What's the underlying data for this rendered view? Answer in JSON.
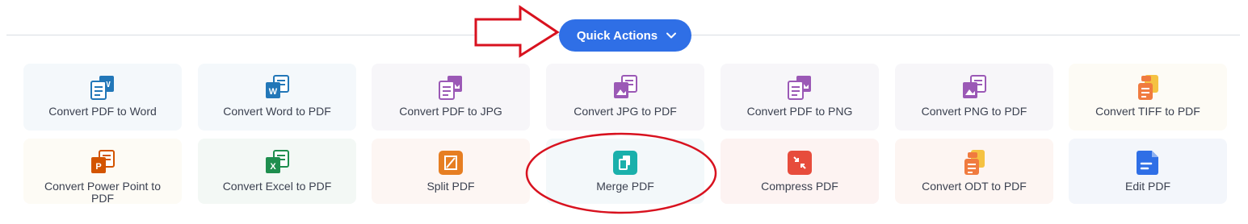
{
  "quick_actions": {
    "label": "Quick Actions"
  },
  "tools_row1": [
    {
      "label": "Convert PDF to Word",
      "icon": "pdf-to-word-icon",
      "bg": "#f4f8fb"
    },
    {
      "label": "Convert Word to PDF",
      "icon": "word-to-pdf-icon",
      "bg": "#f4f8fb"
    },
    {
      "label": "Convert PDF to JPG",
      "icon": "pdf-to-jpg-icon",
      "bg": "#f7f6f9"
    },
    {
      "label": "Convert JPG to PDF",
      "icon": "jpg-to-pdf-icon",
      "bg": "#f7f6f9"
    },
    {
      "label": "Convert PDF to PNG",
      "icon": "pdf-to-png-icon",
      "bg": "#f7f6f9"
    },
    {
      "label": "Convert PNG to PDF",
      "icon": "png-to-pdf-icon",
      "bg": "#f7f6f9"
    },
    {
      "label": "Convert TIFF to PDF",
      "icon": "tiff-to-pdf-icon",
      "bg": "#fdfbf5"
    }
  ],
  "tools_row2": [
    {
      "label": "Convert Power Point to PDF",
      "icon": "ppt-to-pdf-icon",
      "bg": "#fdfbf5"
    },
    {
      "label": "Convert Excel to PDF",
      "icon": "excel-to-pdf-icon",
      "bg": "#f3f8f5"
    },
    {
      "label": "Split PDF",
      "icon": "split-pdf-icon",
      "bg": "#fdf6f3"
    },
    {
      "label": "Merge PDF",
      "icon": "merge-pdf-icon",
      "bg": "#f3f8fa"
    },
    {
      "label": "Compress PDF",
      "icon": "compress-pdf-icon",
      "bg": "#fdf3f2"
    },
    {
      "label": "Convert ODT to PDF",
      "icon": "odt-to-pdf-icon",
      "bg": "#fdf5f2"
    },
    {
      "label": "Edit PDF",
      "icon": "edit-pdf-icon",
      "bg": "#f3f6fb"
    }
  ],
  "colors": {
    "accent_blue": "#2f6fe6",
    "annotation_red": "#d8121f"
  }
}
